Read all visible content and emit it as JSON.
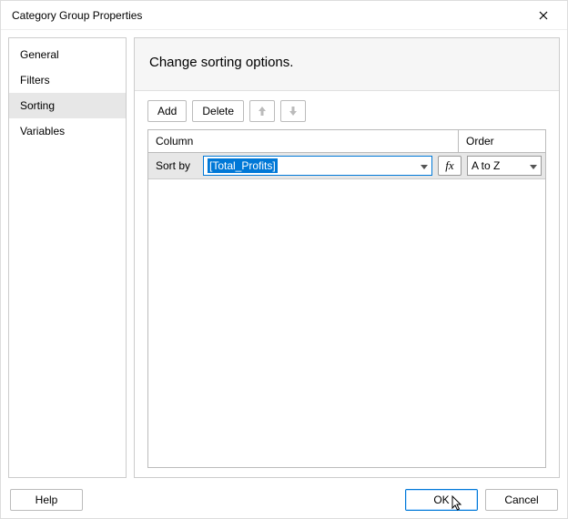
{
  "title": "Category Group Properties",
  "sidebar": {
    "items": [
      {
        "label": "General",
        "selected": false
      },
      {
        "label": "Filters",
        "selected": false
      },
      {
        "label": "Sorting",
        "selected": true
      },
      {
        "label": "Variables",
        "selected": false
      }
    ]
  },
  "main": {
    "header": "Change sorting options.",
    "toolbar": {
      "add_label": "Add",
      "delete_label": "Delete"
    },
    "grid": {
      "column_header": "Column",
      "order_header": "Order",
      "row": {
        "sortby_label": "Sort by",
        "expression": "[Total_Profits]",
        "fx_label": "fx",
        "order_value": "A to Z"
      }
    }
  },
  "footer": {
    "help_label": "Help",
    "ok_label": "OK",
    "cancel_label": "Cancel"
  }
}
